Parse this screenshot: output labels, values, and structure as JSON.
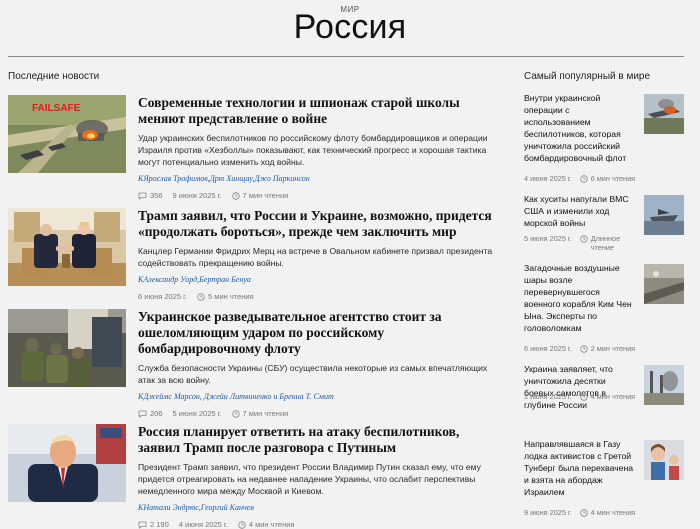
{
  "header": {
    "section": "МИР",
    "title": "Россия"
  },
  "left_heading": "Последние новости",
  "right_heading": "Самый популярный в мире",
  "articles": [
    {
      "title": "Современные технологии и шпионаж старой школы меняют представление о войне",
      "description": "Удар украинских беспилотников по российскому флоту бомбардировщиков и операции Израиля против «Хезболлы» показывают, как технический прогресс и хорошая тактика могут потенциально изменить ход войны.",
      "authors_prefix": "К",
      "authors": "Ярослав Трофимов,Дрю Хинщау,Джо Паркинсон",
      "comments": "356",
      "date": "9 июня 2025 г.",
      "read_time": "7 мин чтения",
      "image_label": "FAILSAFE"
    },
    {
      "title": "Трамп заявил, что России и Украине, возможно, придется «продолжать бороться», прежде чем заключить мир",
      "description": "Канцлер Германии Фридрих Мерц на встрече в Овальном кабинете призвал президента содействовать прекращению войны.",
      "authors_prefix": "К",
      "authors": "Александр Уорд,Бертран Бенуа",
      "comments": "",
      "date": "6 июня 2025 г.",
      "read_time": "5 мин чтения"
    },
    {
      "title": "Украинское разведывательное агентство стоит за ошеломляющим ударом по российскому бомбардировочному флоту",
      "description": "Служба безопасности Украины (СБУ) осуществила некоторые из самых впечатляющих атак за всю войну.",
      "authors_prefix": "К",
      "authors": "Джеймс Марсон, Джейн Литвиненко и Бренна Т. Смит",
      "comments": "206",
      "date": "5 июня 2025 г.",
      "read_time": "7 мин чтения"
    },
    {
      "title": "Россия планирует ответить на атаку беспилотников, заявил Трамп после разговора с Путиным",
      "description": "Президент Трамп заявил, что президент России Владимир Путин сказал ему, что ему придется отреагировать на недавнее нападение Украины, что ослабит перспективы немедленного мира между Москвой и Киевом.",
      "authors_prefix": "К",
      "authors": "Натали Эндрюс,Георгий Канчев",
      "comments": "2 190",
      "date": "4 июня 2025 г.",
      "read_time": "4 мин чтения"
    }
  ],
  "popular": [
    {
      "title": "Внутри украинской операции с использованием беспилотников, которая уничтожила российский бомбардировочный флот",
      "date": "4 июня 2025 г.",
      "read_time": "6 мин чтения"
    },
    {
      "title": "Как хуситы напугали ВМС США и изменили ход морской войны",
      "date": "5 июня 2025 г.",
      "read_time": "Длинное чтение"
    },
    {
      "title": "Загадочные воздушные шары возле перевернувшегося военного корабля Ким Чен Ына. Эксперты по головоломкам",
      "date": "6 июня 2025 г.",
      "read_time": "2 мин чтения"
    },
    {
      "title": "Украина заявляет, что уничтожила десятки боевых самолетов в глубине России",
      "date": "1 июня 2025 г.",
      "read_time": "4 мин чтения"
    },
    {
      "title": "Направлявшаяся в Газу лодка активистов с Гретой Тунберг была перехвачена и взята на абордаж Израилем",
      "date": "9 июня 2025 г.",
      "read_time": "4 мин чтения"
    }
  ],
  "colors": {
    "background": "#f2f2f2",
    "author_link": "#1d5aa8",
    "meta_text": "#777777",
    "image_badge": "#e02020"
  },
  "icons": {
    "comments": "comment-bubble-icon",
    "read_time": "clock-icon"
  }
}
